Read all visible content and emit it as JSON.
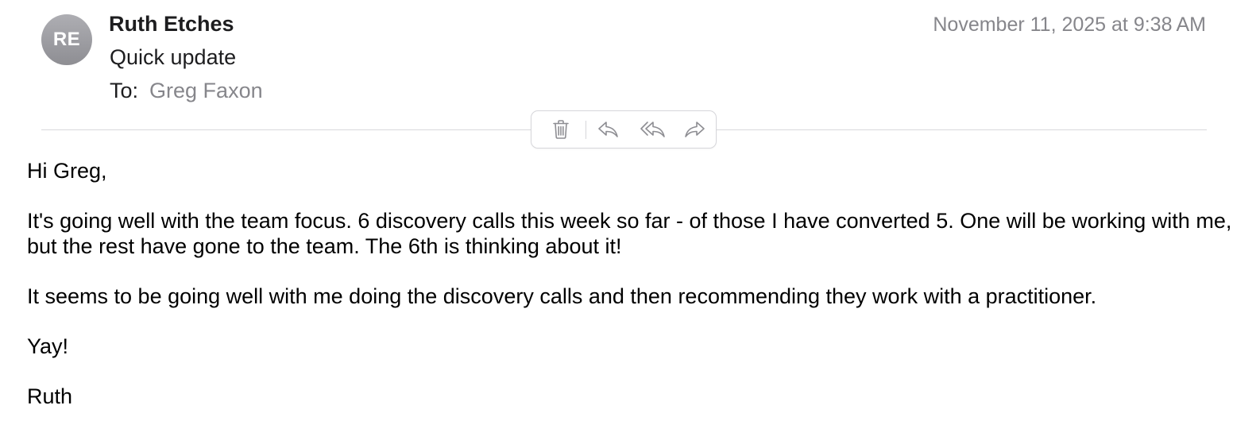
{
  "message": {
    "avatar_initials": "RE",
    "sender": "Ruth Etches",
    "date": "November 11, 2025 at 9:38 AM",
    "subject": "Quick update",
    "to_label": "To:",
    "to_value": "Greg Faxon"
  },
  "toolbar": {
    "icons": [
      "trash-icon",
      "reply-icon",
      "reply-all-icon",
      "forward-icon"
    ]
  },
  "body": {
    "greeting": "Hi Greg,",
    "paragraph_1": "It's going well with the team focus.  6 discovery calls this week so far - of those I have converted 5.  One will be working with me, but the rest have gone to the team.  The 6th is thinking about it!",
    "paragraph_2": "It seems to be going well with me doing the discovery calls and then recommending they work with a practitioner.",
    "paragraph_3": "Yay!",
    "signature": "Ruth"
  },
  "colors": {
    "avatar": "#8e8e93",
    "secondary_text": "#86868b",
    "icon": "#8e8e93"
  }
}
